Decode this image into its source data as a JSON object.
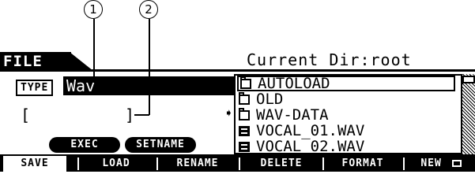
{
  "callouts": {
    "one": "1",
    "two": "2"
  },
  "header": {
    "title": "FILE",
    "current_dir": "Current Dir:root"
  },
  "type_selector": {
    "label": "TYPE",
    "value": "Wav"
  },
  "name_field": {
    "open": "[",
    "close": "]"
  },
  "arrow": "➧",
  "buttons": {
    "exec": "EXEC",
    "set_name": "SETNAME"
  },
  "file_list": [
    {
      "name": "AUTOLOAD",
      "kind": "folder",
      "selected": true
    },
    {
      "name": "OLD",
      "kind": "folder",
      "selected": false
    },
    {
      "name": "WAV-DATA",
      "kind": "folder",
      "selected": false
    },
    {
      "name": "VOCAL_01.WAV",
      "kind": "wav",
      "selected": false
    },
    {
      "name": "VOCAL_02.WAV",
      "kind": "wav",
      "selected": false
    }
  ],
  "tabs": [
    {
      "label": "SAVE",
      "active": true
    },
    {
      "label": "LOAD",
      "active": false
    },
    {
      "label": "RENAME",
      "active": false
    },
    {
      "label": "DELETE",
      "active": false
    },
    {
      "label": "FORMAT",
      "active": false
    },
    {
      "label": "NEW",
      "active": false
    }
  ]
}
